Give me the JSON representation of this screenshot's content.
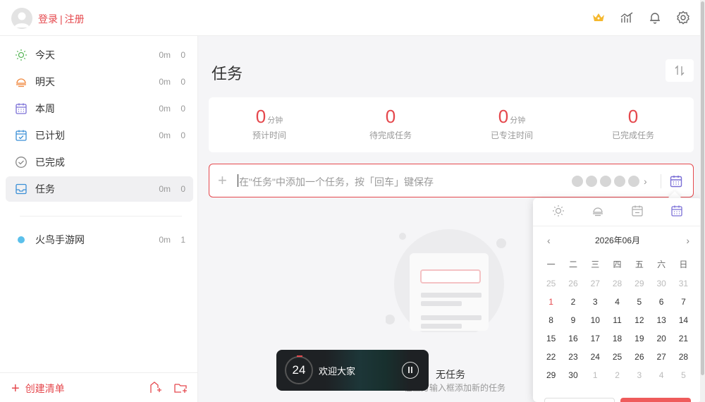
{
  "header": {
    "login": "登录",
    "separator": "|",
    "register": "注册",
    "icons": [
      "crown-icon",
      "stats-icon",
      "bell-icon",
      "settings-icon"
    ]
  },
  "sidebar": {
    "items": [
      {
        "label": "今天",
        "time": "0m",
        "count": "0",
        "icon": "sun-icon"
      },
      {
        "label": "明天",
        "time": "0m",
        "count": "0",
        "icon": "sunset-icon"
      },
      {
        "label": "本周",
        "time": "0m",
        "count": "0",
        "icon": "week-calendar-icon"
      },
      {
        "label": "已计划",
        "time": "0m",
        "count": "0",
        "icon": "planned-calendar-icon"
      },
      {
        "label": "已完成",
        "time": "",
        "count": "",
        "icon": "check-circle-icon"
      },
      {
        "label": "任务",
        "time": "0m",
        "count": "0",
        "icon": "inbox-icon"
      }
    ],
    "lists": [
      {
        "label": "火鸟手游网",
        "time": "0m",
        "count": "1",
        "color": "#5bc0eb"
      }
    ],
    "create_list": "创建清单"
  },
  "main": {
    "title": "任务",
    "stats": [
      {
        "value": "0",
        "unit": "分钟",
        "caption": "预计时间"
      },
      {
        "value": "0",
        "unit": "",
        "caption": "待完成任务"
      },
      {
        "value": "0",
        "unit": "分钟",
        "caption": "已专注时间"
      },
      {
        "value": "0",
        "unit": "",
        "caption": "已完成任务"
      }
    ],
    "input_placeholder": "在\"任务\"中添加一个任务，按「回车」键保存",
    "empty_title": "无任务",
    "empty_sub": "在上方输入框添加新的任务"
  },
  "calendar": {
    "month": "2026年06月",
    "weekdays": [
      "一",
      "二",
      "三",
      "四",
      "五",
      "六",
      "日"
    ],
    "days": [
      [
        "25",
        "m"
      ],
      [
        "26",
        "m"
      ],
      [
        "27",
        "m"
      ],
      [
        "28",
        "m"
      ],
      [
        "29",
        "m"
      ],
      [
        "30",
        "m"
      ],
      [
        "31",
        "m"
      ],
      [
        "1",
        "t"
      ],
      [
        "2",
        ""
      ],
      [
        "3",
        ""
      ],
      [
        "4",
        ""
      ],
      [
        "5",
        ""
      ],
      [
        "6",
        ""
      ],
      [
        "7",
        ""
      ],
      [
        "8",
        ""
      ],
      [
        "9",
        ""
      ],
      [
        "10",
        ""
      ],
      [
        "11",
        ""
      ],
      [
        "12",
        ""
      ],
      [
        "13",
        ""
      ],
      [
        "14",
        ""
      ],
      [
        "15",
        ""
      ],
      [
        "16",
        ""
      ],
      [
        "17",
        ""
      ],
      [
        "18",
        ""
      ],
      [
        "19",
        ""
      ],
      [
        "20",
        ""
      ],
      [
        "21",
        ""
      ],
      [
        "22",
        ""
      ],
      [
        "23",
        ""
      ],
      [
        "24",
        ""
      ],
      [
        "25",
        ""
      ],
      [
        "26",
        ""
      ],
      [
        "27",
        ""
      ],
      [
        "28",
        ""
      ],
      [
        "29",
        ""
      ],
      [
        "30",
        ""
      ],
      [
        "1",
        "m"
      ],
      [
        "2",
        "m"
      ],
      [
        "3",
        "m"
      ],
      [
        "4",
        "m"
      ],
      [
        "5",
        "m"
      ]
    ]
  },
  "player": {
    "timer": "24",
    "title": "欢迎大家"
  },
  "colors": {
    "accent": "#e5484d",
    "calendar": "#7b6fd6"
  }
}
